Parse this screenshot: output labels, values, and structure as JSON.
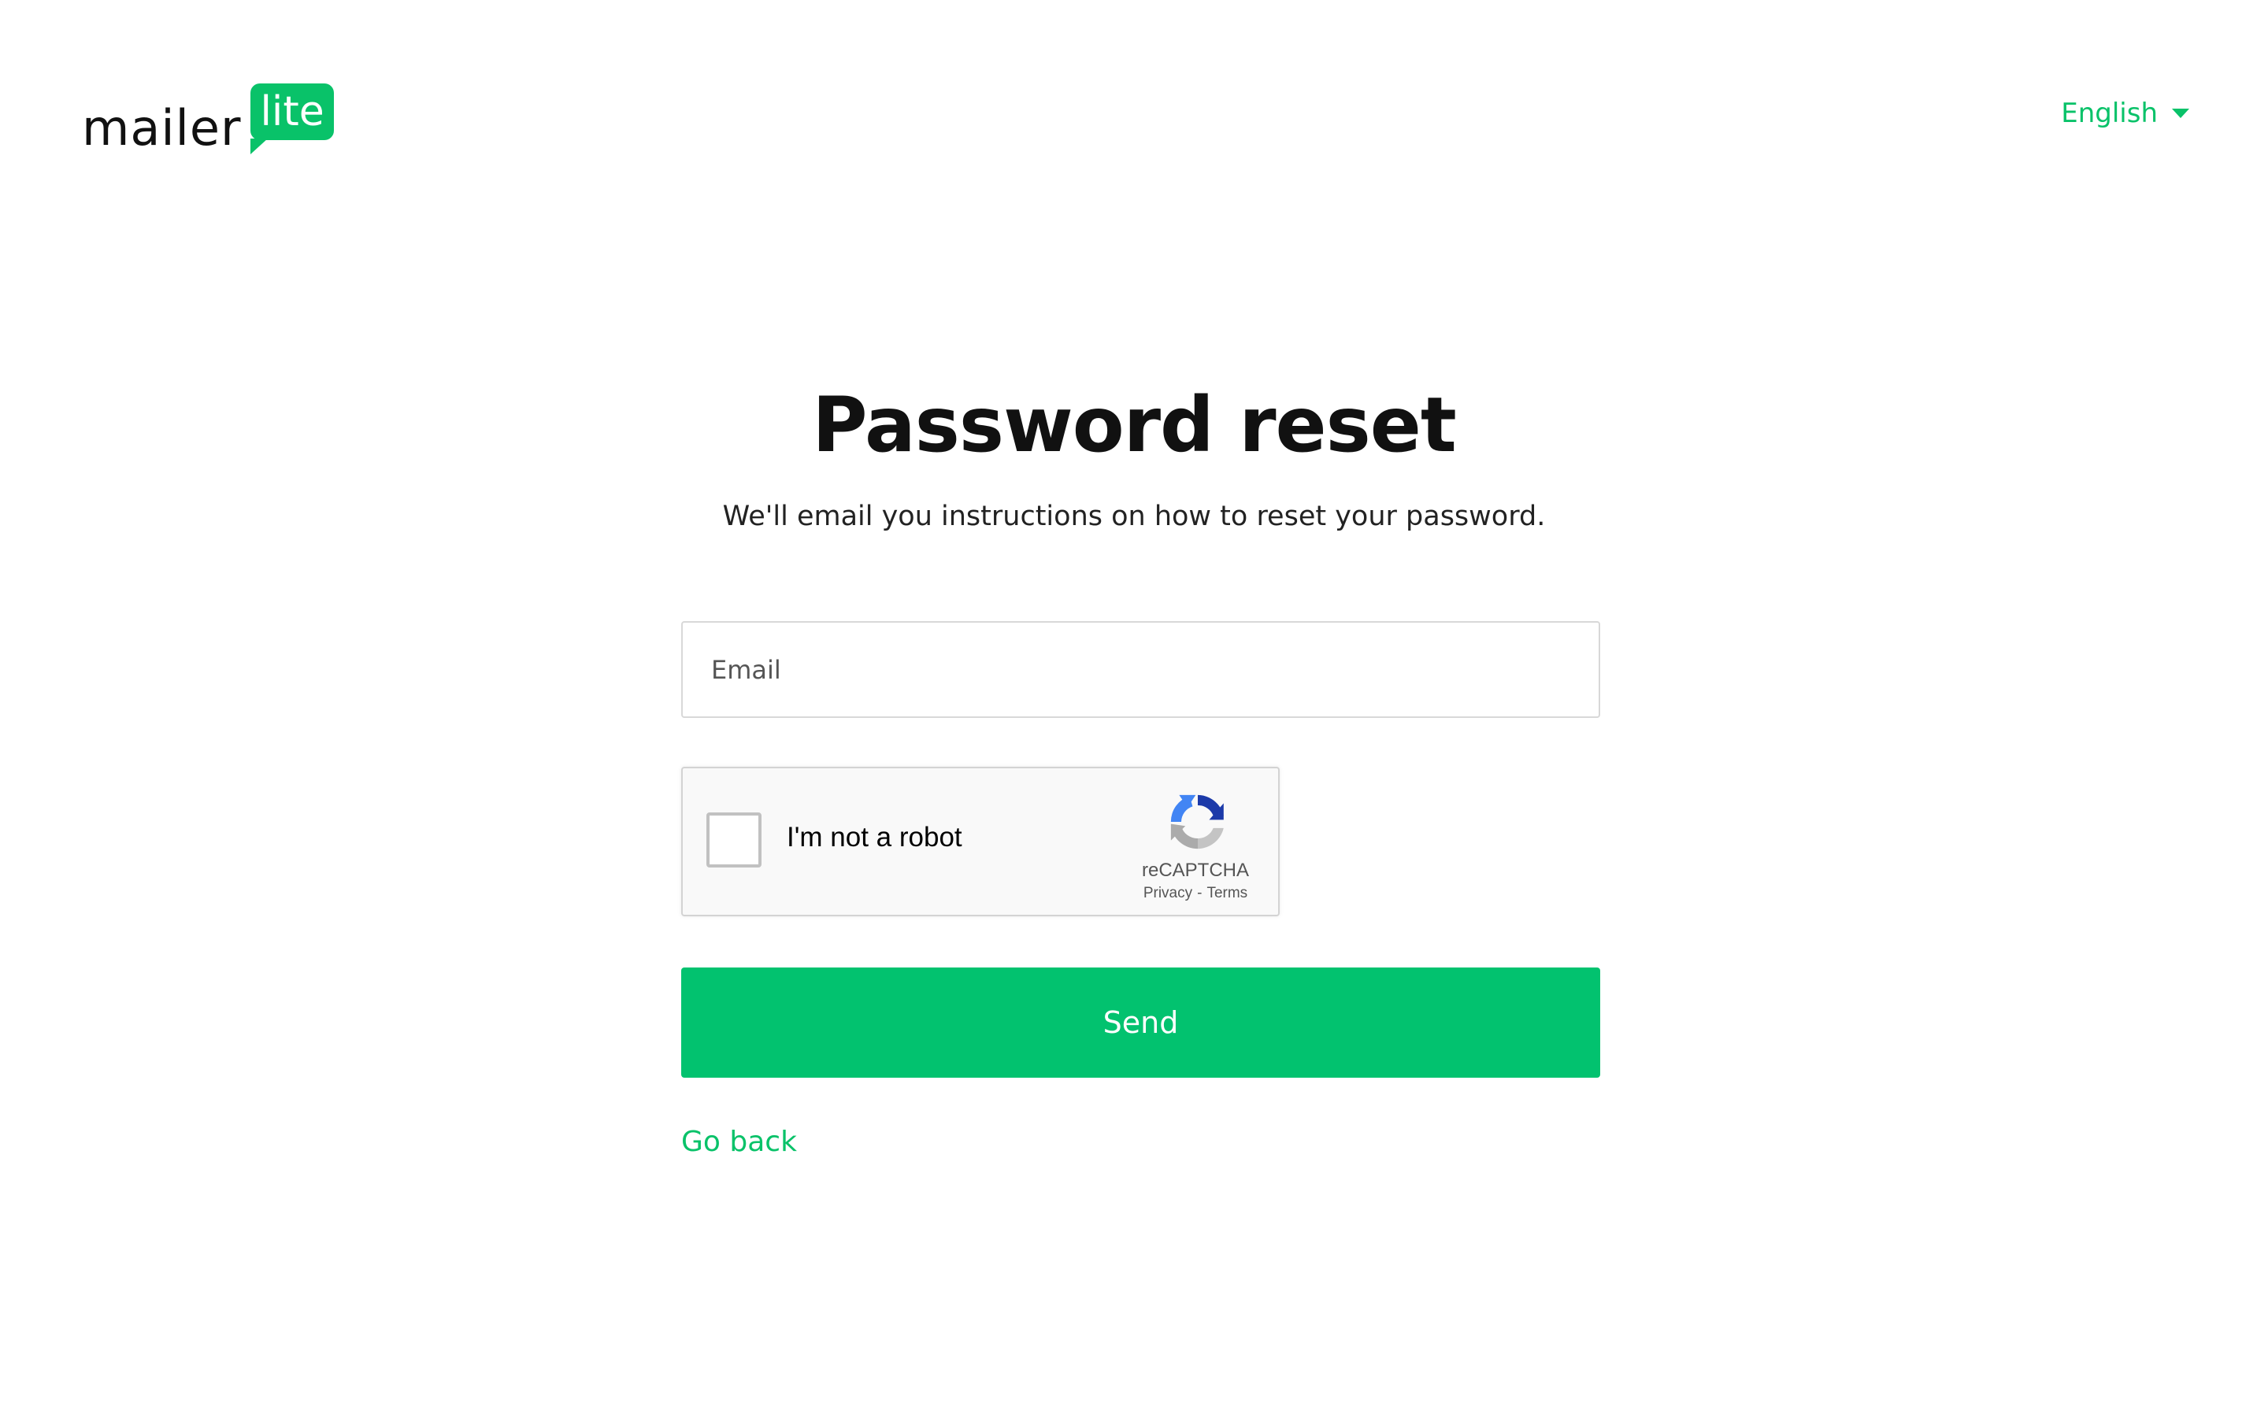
{
  "header": {
    "logo_word": "mailer",
    "logo_badge": "lite",
    "language": "English",
    "language_icon": "chevron-down-icon"
  },
  "main": {
    "title": "Password reset",
    "subtitle": "We'll email you instructions on how to reset your password.",
    "email_placeholder": "Email",
    "email_value": "",
    "recaptcha": {
      "label": "I'm not a robot",
      "brand": "reCAPTCHA",
      "privacy": "Privacy",
      "separator": "-",
      "terms": "Terms",
      "checked": false
    },
    "send_label": "Send",
    "go_back_label": "Go back"
  },
  "colors": {
    "brand_green": "#09c269",
    "button_green": "#02c26f",
    "text": "#111111",
    "background": "#ffffff"
  }
}
